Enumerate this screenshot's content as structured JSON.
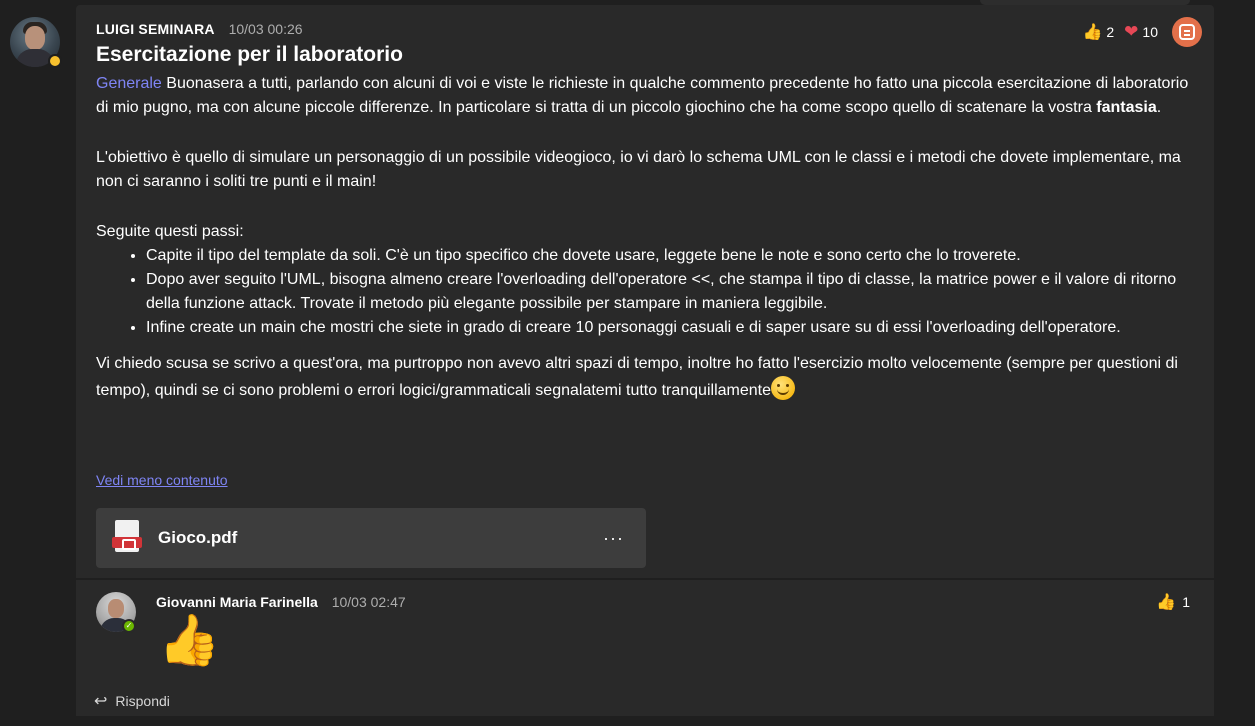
{
  "post": {
    "author": "LUIGI SEMINARA",
    "timestamp": "10/03 00:26",
    "title": "Esercitazione per il laboratorio",
    "reactions": {
      "like_count": "2",
      "heart_count": "10"
    },
    "body": {
      "mention": "Generale",
      "p1_text": " Buonasera a tutti, parlando con alcuni di voi e viste le richieste in qualche commento precedente ho fatto una piccola esercitazione di laboratorio di mio pugno, ma con alcune piccole differenze. In particolare si tratta di un piccolo giochino che ha come scopo quello di scatenare la vostra ",
      "p1_bold": "fantasia",
      "p1_end": ".",
      "p2": "L'obiettivo è quello di simulare un personaggio di un possibile videogioco, io vi darò lo schema UML con le classi e i metodi che dovete implementare, ma non ci saranno i soliti tre punti e il main!",
      "p3": "Seguite questi passi:",
      "steps": [
        "Capite il tipo del template da soli. C'è un tipo specifico che dovete usare, leggete bene le note e sono certo che lo troverete.",
        "Dopo aver seguito l'UML, bisogna almeno creare l'overloading dell'operatore <<, che stampa il tipo di classe, la matrice power e il valore di ritorno della funzione attack. Trovate il metodo più elegante possibile per stampare in maniera leggibile.",
        "Infine create un main che mostri che siete in grado di creare 10 personaggi casuali e di saper usare su di essi l'overloading dell'operatore."
      ],
      "p4": "Vi chiedo scusa se scrivo a quest'ora, ma purtroppo non avevo altri spazi di tempo, inoltre ho fatto l'esercizio molto velocemente (sempre per questioni di tempo), quindi se ci sono problemi o errori logici/grammaticali segnalatemi tutto tranquillamente"
    },
    "show_less_label": "Vedi meno contenuto",
    "attachment": {
      "file_name": "Gioco.pdf",
      "more_label": "···"
    }
  },
  "reply": {
    "author": "Giovanni Maria Farinella",
    "timestamp": "10/03 02:47",
    "like_count": "1",
    "content_emoji": "👍",
    "reply_label": "Rispondi"
  },
  "icons": {
    "like": "👍",
    "heart": "❤",
    "reply_arrow": "↩"
  },
  "colors": {
    "background": "#1f1f1f",
    "card": "#292929",
    "accent_link": "#7f85f5",
    "loop_icon": "#e3704a",
    "presence_away": "#f8c12e",
    "presence_available": "#6bb700"
  }
}
